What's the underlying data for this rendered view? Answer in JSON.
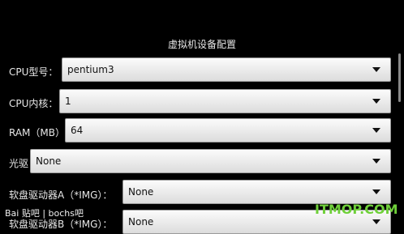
{
  "dialog": {
    "title": "虚拟机设备配置"
  },
  "rows": [
    {
      "label": "CPU型号：",
      "value": "pentium3"
    },
    {
      "label": "CPU内核：",
      "value": "1"
    },
    {
      "label": "RAM（MB）",
      "value": "64"
    },
    {
      "label": "光驱",
      "value": "None"
    },
    {
      "label": "软盘驱动器A（*IMG）：",
      "value": "None"
    },
    {
      "label": "软盘驱动器B（*IMG）：",
      "value": "None"
    }
  ],
  "icons": {
    "dropdown": "chevron-down-icon"
  },
  "watermarks": {
    "left": "Bai 贴吧 | bochs吧",
    "right": "ITMOP.COM"
  },
  "colors": {
    "background": "#000000",
    "field": "#efefef",
    "watermark_right": "#6fd03a"
  }
}
